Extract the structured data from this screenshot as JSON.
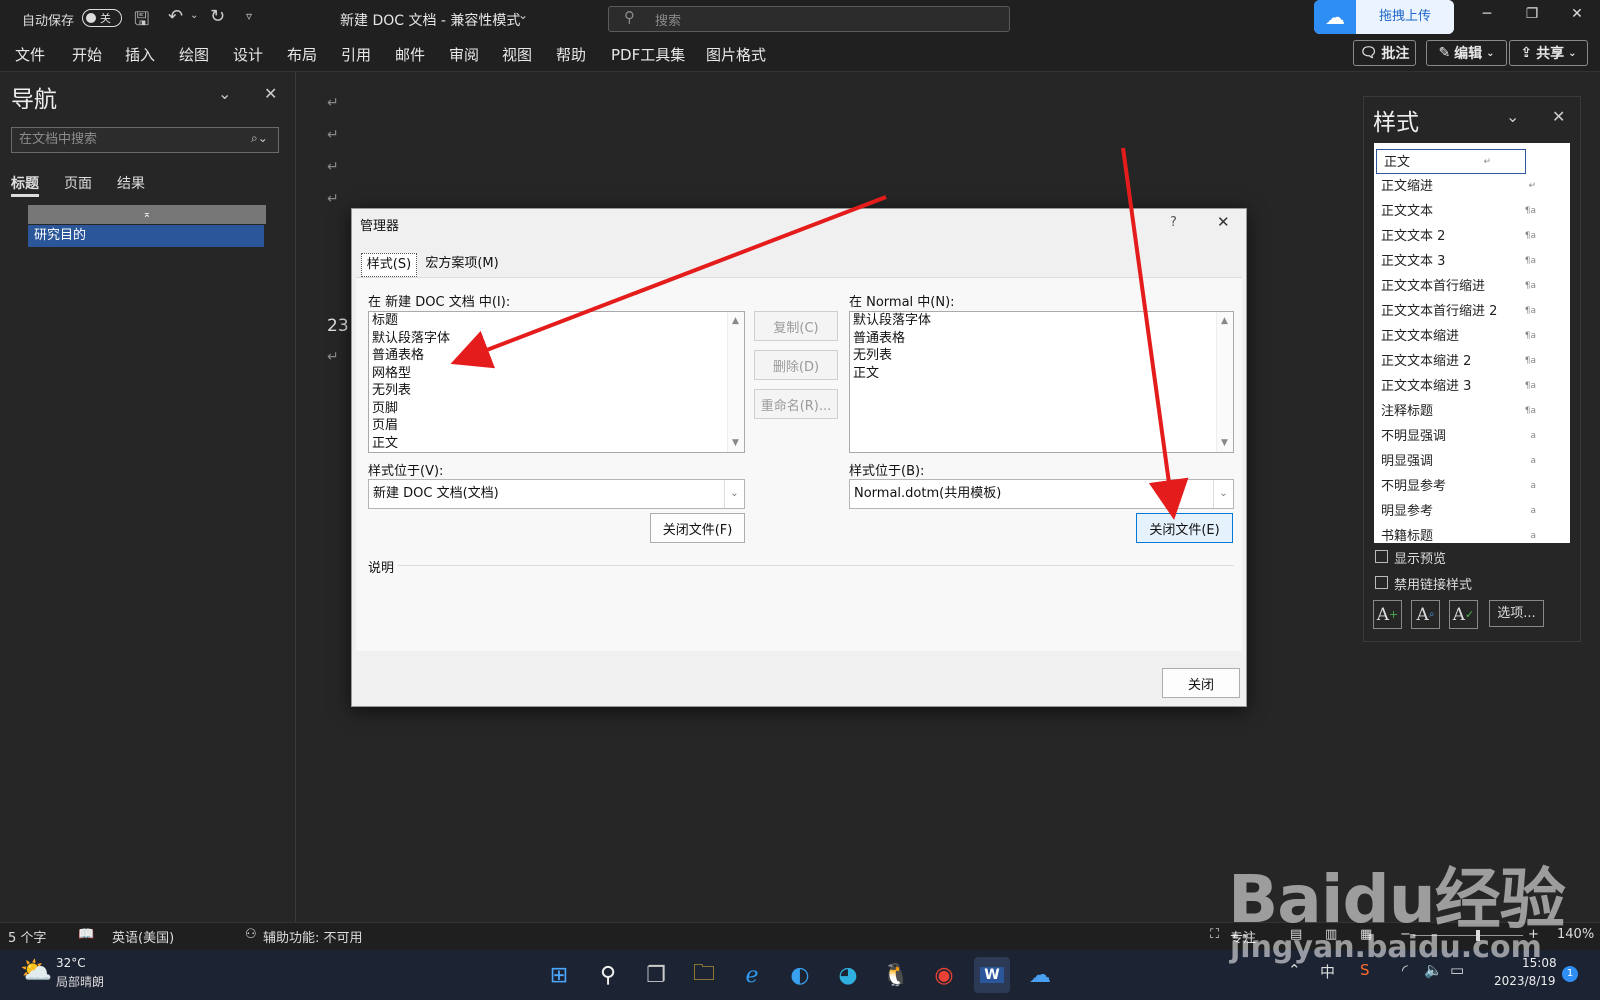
{
  "titlebar": {
    "autosave_label": "自动保存",
    "autosave_state": "关",
    "doc_title": "新建 DOC 文档 - 兼容性模式",
    "search_placeholder": "搜索",
    "upload_label": "拖拽上传",
    "minimize": "─",
    "restore": "❐",
    "close": "✕"
  },
  "menu": {
    "items": [
      "文件",
      "开始",
      "插入",
      "绘图",
      "设计",
      "布局",
      "引用",
      "邮件",
      "审阅",
      "视图",
      "帮助",
      "PDF工具集",
      "图片格式"
    ],
    "comment_btn": "批注",
    "edit_btn": "编辑",
    "share_btn": "共享"
  },
  "nav": {
    "title": "导航",
    "search_placeholder": "在文档中搜索",
    "tabs": [
      "标题",
      "页面",
      "结果"
    ],
    "headings": [
      "研究目的"
    ]
  },
  "document": {
    "visible_text": "23"
  },
  "dialog": {
    "title": "管理器",
    "help": "?",
    "tabs": [
      "样式(S)",
      "宏方案项(M)"
    ],
    "left_label": "在 新建 DOC 文档 中(I):",
    "left_items": [
      "标题",
      "默认段落字体",
      "普通表格",
      "网格型",
      "无列表",
      "页脚",
      "页眉",
      "正文"
    ],
    "right_label": "在 Normal 中(N):",
    "right_items": [
      "默认段落字体",
      "普通表格",
      "无列表",
      "正文"
    ],
    "copy_btn": "复制(C)",
    "delete_btn": "删除(D)",
    "rename_btn": "重命名(R)...",
    "left_loc_label": "样式位于(V):",
    "left_loc_value": "新建 DOC 文档(文档)",
    "right_loc_label": "样式位于(B):",
    "right_loc_value": "Normal.dotm(共用模板)",
    "left_close_file": "关闭文件(F)",
    "right_close_file": "关闭文件(E)",
    "desc_label": "说明",
    "close_btn": "关闭"
  },
  "styles_pane": {
    "title": "样式",
    "items": [
      "正文",
      "正文缩进",
      "正文文本",
      "正文文本 2",
      "正文文本 3",
      "正文文本首行缩进",
      "正文文本首行缩进 2",
      "正文文本缩进",
      "正文文本缩进 2",
      "正文文本缩进 3",
      "注释标题",
      "不明显强调",
      "明显强调",
      "不明显参考",
      "明显参考",
      "书籍标题"
    ],
    "show_preview": "显示预览",
    "disable_linked": "禁用链接样式",
    "options_btn": "选项..."
  },
  "status": {
    "word_count": "5 个字",
    "language": "英语(美国)",
    "accessibility": "辅助功能: 不可用",
    "focus": "专注",
    "zoom": "140%"
  },
  "taskbar": {
    "weather_temp": "32°C",
    "weather_desc": "局部晴朗",
    "ime": "中",
    "time": "15:08",
    "date": "2023/8/19",
    "notification_count": "1"
  },
  "watermark": {
    "brand": "Baidu经验",
    "url": "jingyan.baidu.com"
  },
  "colors": {
    "accent": "#2b579a",
    "arrow": "#e51c1c",
    "selection": "#2b579a"
  }
}
